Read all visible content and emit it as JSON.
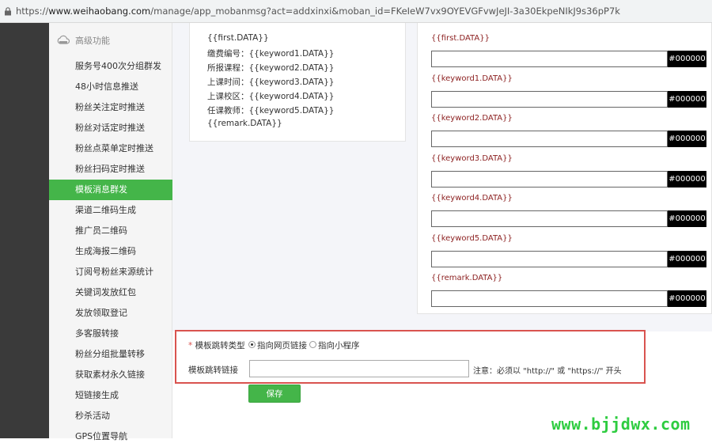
{
  "browser": {
    "url_scheme": "https://",
    "url_host": "www.weihaobang.com",
    "url_path": "/manage/app_mobanmsg?act=addxinxi&moban_id=FKeIeW7vx9OYEVGFvwJeJI-3a30EkpeNIkJ9s36pP7k"
  },
  "sidebar": {
    "section_title": "高级功能",
    "section_icon": "cloud-icon",
    "items": [
      {
        "label": "服务号400次分组群发"
      },
      {
        "label": "48小时信息推送"
      },
      {
        "label": "粉丝关注定时推送"
      },
      {
        "label": "粉丝对话定时推送"
      },
      {
        "label": "粉丝点菜单定时推送"
      },
      {
        "label": "粉丝扫码定时推送"
      },
      {
        "label": "模板消息群发",
        "active": true
      },
      {
        "label": "渠道二维码生成"
      },
      {
        "label": "推广员二维码"
      },
      {
        "label": "生成海报二维码"
      },
      {
        "label": "订阅号粉丝来源统计"
      },
      {
        "label": "关键词发放红包"
      },
      {
        "label": "发放领取登记"
      },
      {
        "label": "多客服转接"
      },
      {
        "label": "粉丝分组批量转移"
      },
      {
        "label": "获取素材永久链接"
      },
      {
        "label": "短链接生成"
      },
      {
        "label": "秒杀活动"
      },
      {
        "label": "GPS位置导航"
      }
    ]
  },
  "preview": {
    "lines": [
      "{{first.DATA}}",
      "缴费编号：{{keyword1.DATA}}",
      "所报课程：{{keyword2.DATA}}",
      "上课时间：{{keyword3.DATA}}",
      "上课校区：{{keyword4.DATA}}",
      "任课教师：{{keyword5.DATA}}",
      "{{remark.DATA}}"
    ]
  },
  "fields": [
    {
      "label": "{{first.DATA}}",
      "value": "",
      "color": "#000000"
    },
    {
      "label": "{{keyword1.DATA}}",
      "value": "",
      "color": "#000000"
    },
    {
      "label": "{{keyword2.DATA}}",
      "value": "",
      "color": "#000000"
    },
    {
      "label": "{{keyword3.DATA}}",
      "value": "",
      "color": "#000000"
    },
    {
      "label": "{{keyword4.DATA}}",
      "value": "",
      "color": "#000000"
    },
    {
      "label": "{{keyword5.DATA}}",
      "value": "",
      "color": "#000000"
    },
    {
      "label": "{{remark.DATA}}",
      "value": "",
      "color": "#000000"
    }
  ],
  "jump": {
    "required_mark": "*",
    "type_label": "模板跳转类型",
    "options": [
      {
        "label": "指向网页链接",
        "checked": true
      },
      {
        "label": "指向小程序",
        "checked": false
      }
    ],
    "link_label": "模板跳转链接",
    "link_value": "",
    "note": "注意：必须以 \"http://\" 或 \"https://\" 开头"
  },
  "actions": {
    "save_label": "保存"
  },
  "watermark": "www.bjjdwx.com",
  "colors": {
    "accent": "#44b549",
    "highlight_box": "#d9534f",
    "field_label": "#8b1e1e"
  }
}
